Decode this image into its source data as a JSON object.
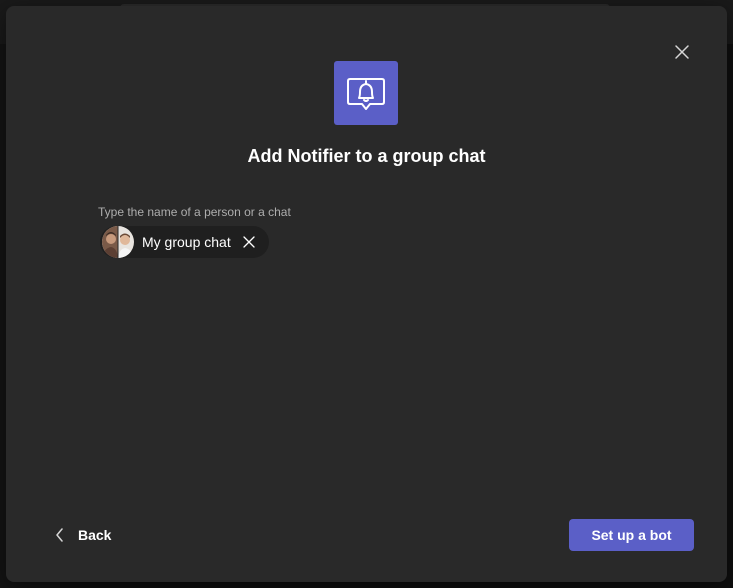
{
  "dialog": {
    "title": "Add Notifier to a group chat",
    "app_icon": "bell-notification-icon",
    "field_label": "Type the name of a person or a chat",
    "selected_chat": {
      "label": "My group chat",
      "avatar_icon": "group-avatar-icon",
      "remove_icon": "close-icon"
    },
    "close_icon": "close-icon",
    "footer": {
      "back_label": "Back",
      "back_icon": "chevron-left-icon",
      "primary_label": "Set up a bot"
    }
  },
  "colors": {
    "accent": "#5b5fc7",
    "dialog_bg": "#292929",
    "chip_bg": "#1f1f1f",
    "label_text": "#adadad"
  }
}
